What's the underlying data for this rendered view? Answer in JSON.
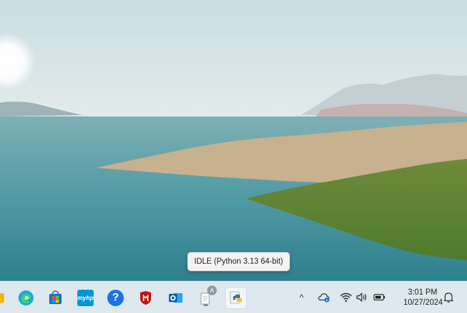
{
  "tooltip": {
    "text": "IDLE (Python 3.13 64-bit)"
  },
  "taskbar": {
    "apps": [
      {
        "name": "Microsoft Edge",
        "icon": "edge-icon"
      },
      {
        "name": "Microsoft Store",
        "icon": "store-icon"
      },
      {
        "name": "myHP",
        "icon": "myhp-icon",
        "label": "myhp"
      },
      {
        "name": "Get Help",
        "icon": "help-icon",
        "label": "?"
      },
      {
        "name": "McAfee",
        "icon": "mcafee-icon"
      },
      {
        "name": "Outlook",
        "icon": "outlook-icon",
        "label": "o"
      },
      {
        "name": "Notepad",
        "icon": "notepad-icon",
        "badge": "A"
      },
      {
        "name": "IDLE",
        "icon": "python-icon",
        "active": true
      }
    ],
    "clock": {
      "time": "3:01 PM",
      "date": "10/27/2024"
    }
  },
  "colors": {
    "accent": "#0078d4",
    "taskbar_bg": "#dde9ef"
  }
}
